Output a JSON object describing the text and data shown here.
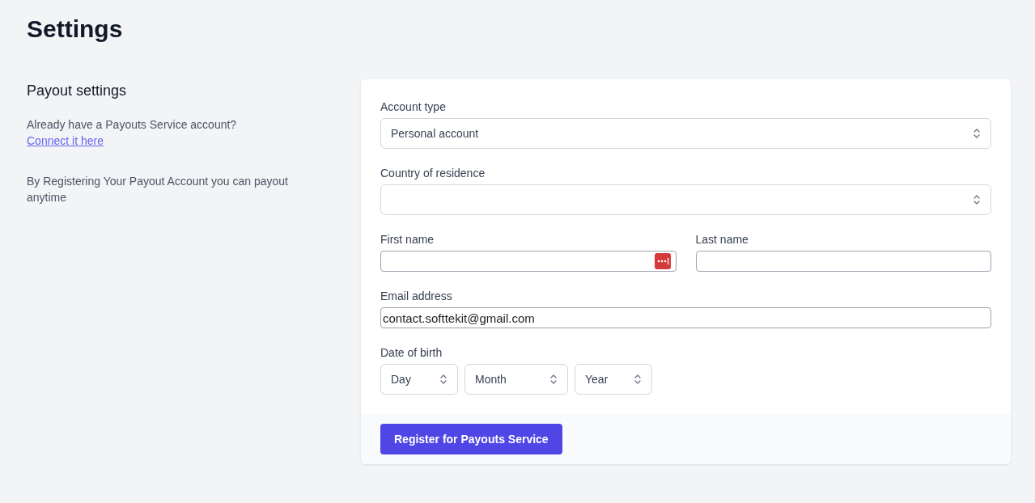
{
  "page_title": "Settings",
  "section": {
    "title": "Payout settings",
    "intro": "Already have a Payouts Service account?",
    "link": "Connect it here",
    "note": "By Registering Your Payout Account you can payout anytime"
  },
  "form": {
    "rows": [
      {
        "fields": [
          {
            "kind": "select",
            "label": "Account type",
            "value": "Personal account"
          }
        ]
      },
      {
        "fields": [
          {
            "kind": "select",
            "label": "Country of residence"
          }
        ]
      },
      {
        "fields": [
          {
            "kind": "text",
            "label": "First name",
            "autofill": true
          },
          {
            "kind": "text",
            "label": "Last name"
          }
        ]
      },
      {
        "fields": [
          {
            "kind": "text",
            "label": "Email address",
            "value": "contact.softtekit@gmail.com"
          }
        ]
      },
      {
        "fields": [
          {
            "kind": "date",
            "label": "Date of birth",
            "parts": [
              {
                "placeholder": "Day"
              },
              {
                "placeholder": "Month"
              },
              {
                "placeholder": "Year"
              }
            ]
          }
        ]
      }
    ],
    "submit": "Register for Payouts Service"
  }
}
